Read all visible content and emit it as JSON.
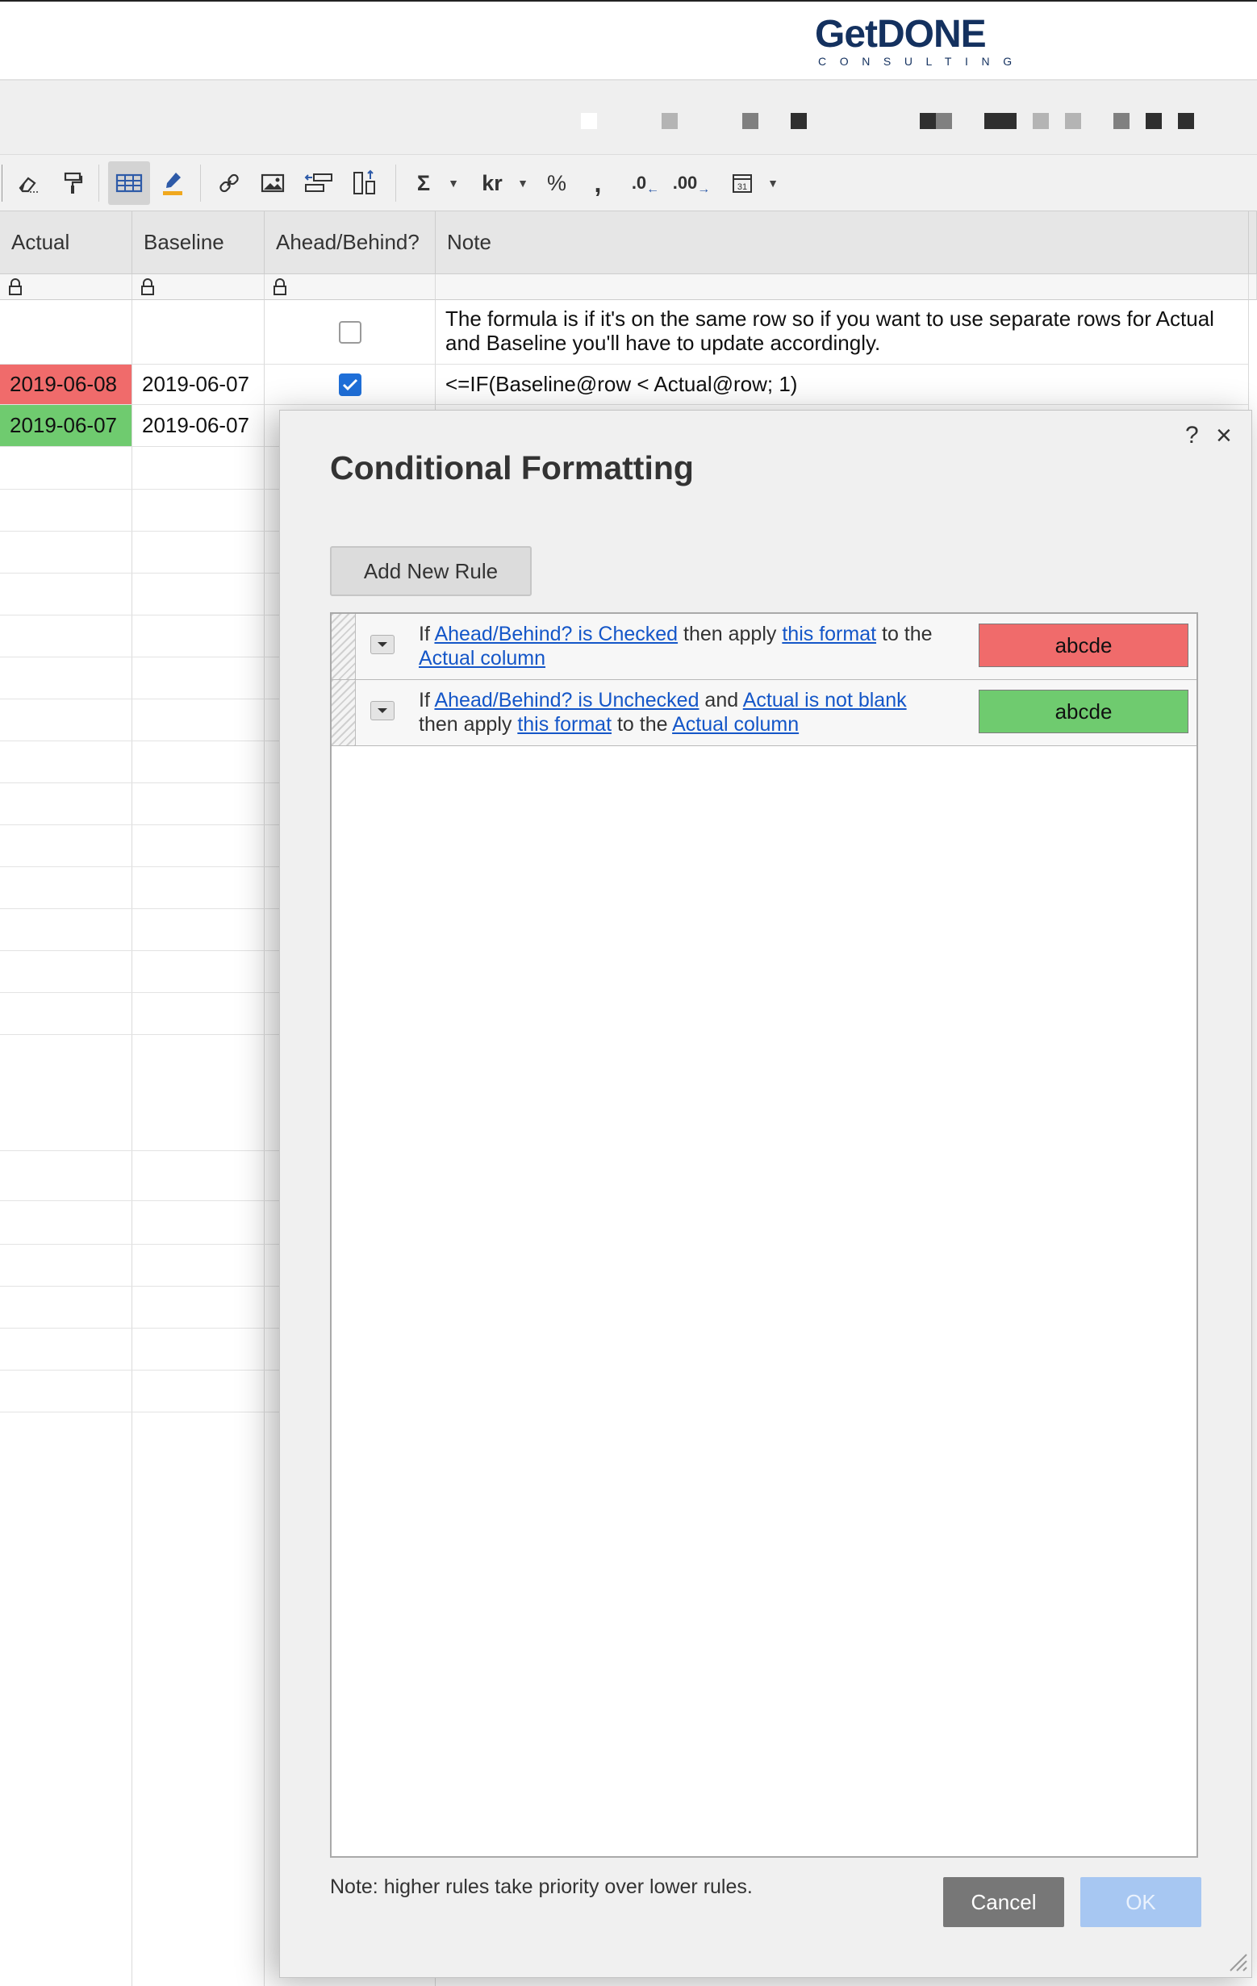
{
  "logo": {
    "brand_prefix": "Get",
    "brand_main": "DONE",
    "tagline": "CONSULTING"
  },
  "toolbar": {
    "items": [
      "eraser-icon",
      "format-painter-icon",
      "grid-view-icon",
      "highlight-pen-icon",
      "link-icon",
      "image-icon",
      "indent-icon",
      "move-icon",
      "sum-icon",
      "currency-icon",
      "percent-icon",
      "thousands-separator-icon",
      "decrease-decimal-icon",
      "increase-decimal-icon",
      "date-format-icon"
    ],
    "sum_symbol": "Σ",
    "currency_label": "kr",
    "percent_symbol": "%",
    "comma_symbol": ",",
    "decrease_decimal_label": ".0",
    "increase_decimal_label": ".00"
  },
  "grid": {
    "columns": [
      "Actual",
      "Baseline",
      "Ahead/Behind?",
      "Note"
    ],
    "rows": [
      {
        "actual": "",
        "baseline": "",
        "checked": false,
        "note": "The formula is if it's on the same row so if you want to use separate rows for Actual and Baseline you'll have to update accordingly.",
        "actual_color": ""
      },
      {
        "actual": "2019-06-08",
        "baseline": "2019-06-07",
        "checked": true,
        "note": "<=IF(Baseline@row < Actual@row; 1)",
        "actual_color": "#f06b6b"
      },
      {
        "actual": "2019-06-07",
        "baseline": "2019-06-07",
        "checked": false,
        "note": "",
        "actual_color": "#6fcb6f"
      }
    ]
  },
  "dialog": {
    "help_label": "?",
    "close_label": "×",
    "title": "Conditional Formatting",
    "add_rule_label": "Add New Rule",
    "rules": [
      {
        "parts": [
          "If ",
          "Ahead/Behind? is Checked",
          " then apply ",
          "this format",
          " to the ",
          "Actual column"
        ],
        "swatch_label": "abcde",
        "swatch_color": "#f06b6b"
      },
      {
        "parts": [
          "If ",
          "Ahead/Behind? is Unchecked",
          " and ",
          "Actual is not blank",
          " then apply ",
          "this format",
          " to the ",
          "Actual column"
        ],
        "swatch_label": "abcde",
        "swatch_color": "#6fcb6f"
      }
    ],
    "note": "Note: higher rules take priority over lower rules.",
    "cancel_label": "Cancel",
    "ok_label": "OK"
  },
  "colors": {
    "accent": "#1f6fd8",
    "link": "#1456c8",
    "behind": "#f06b6b",
    "ahead": "#6fcb6f",
    "brand": "#14315f"
  }
}
